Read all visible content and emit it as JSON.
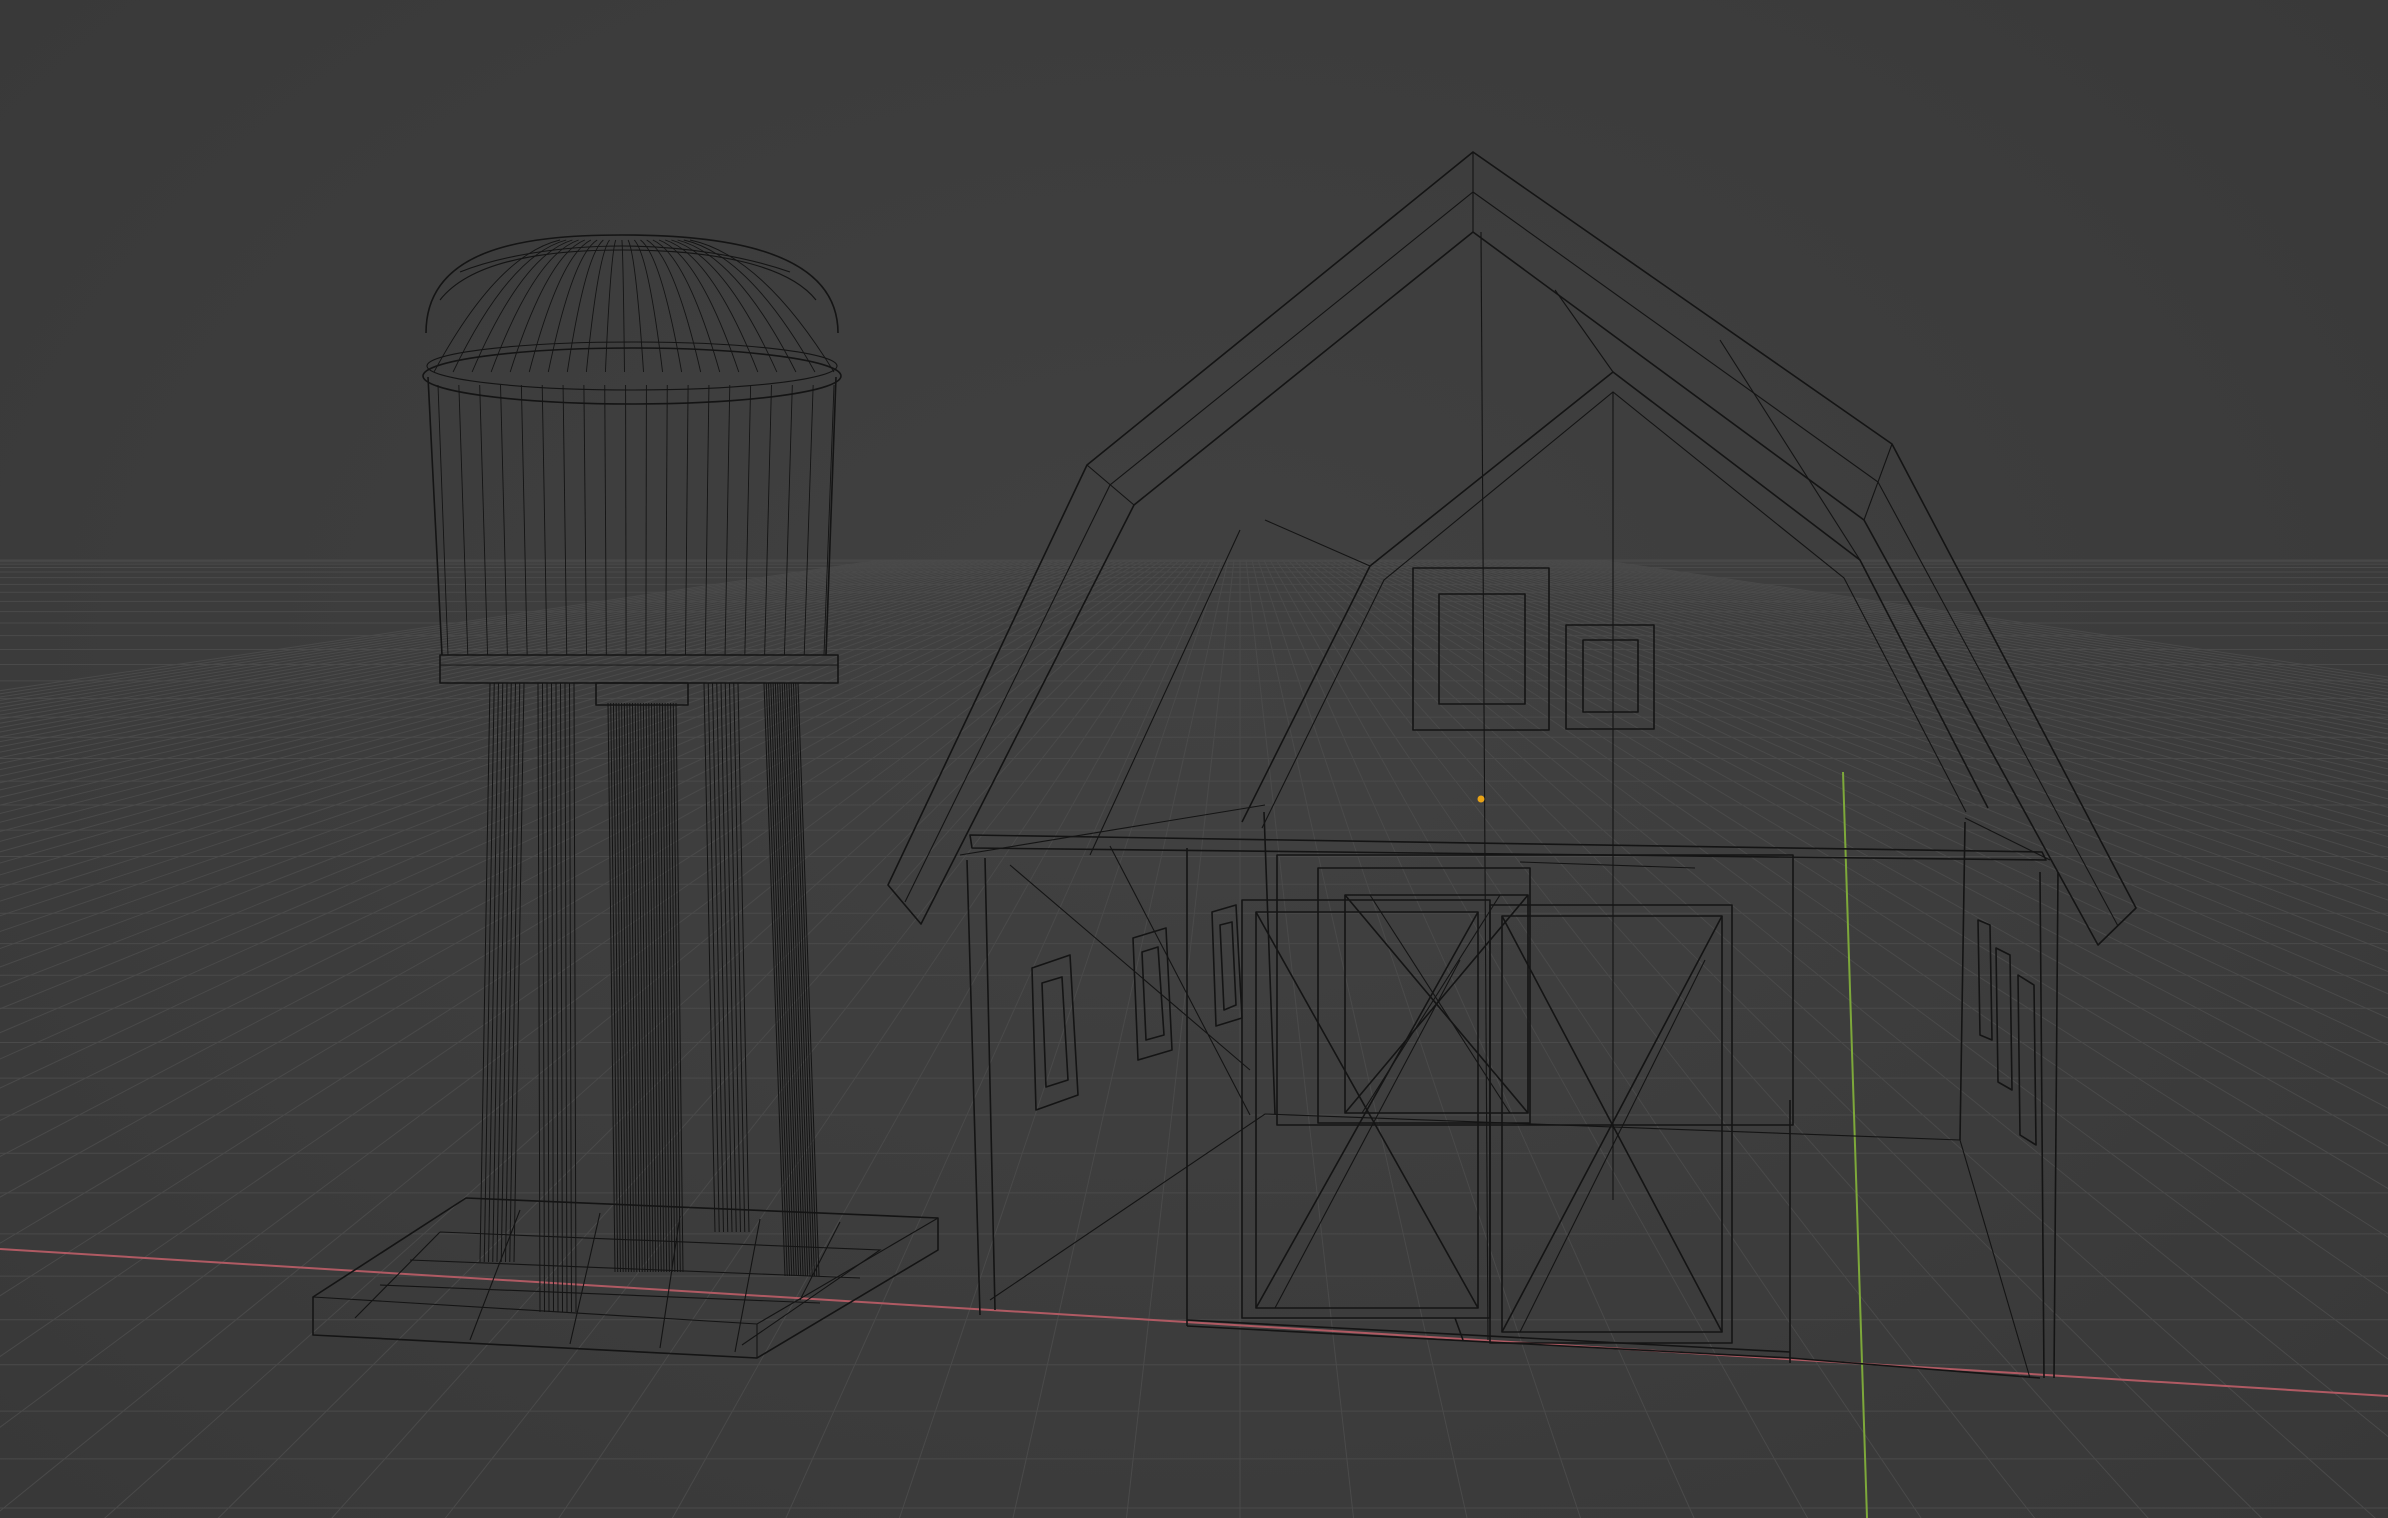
{
  "app": {
    "name": "3D viewport",
    "shading_mode": "wireframe",
    "view": "perspective"
  },
  "colors": {
    "background": "#3d3d3d",
    "grid_line": "#4a4a4a",
    "wireframe": "#141414",
    "x_axis": "#b05a63",
    "y_axis": "#7da83a",
    "origin_point": "#e8a317"
  },
  "scene": {
    "objects": [
      {
        "name": "water-tower",
        "legs": 5,
        "shape": "tank-on-legs"
      },
      {
        "name": "barn",
        "shape": "gambrel-roof",
        "windows": 7,
        "doors": 2
      }
    ],
    "grid": true,
    "axes_shown": [
      "x",
      "y"
    ]
  }
}
